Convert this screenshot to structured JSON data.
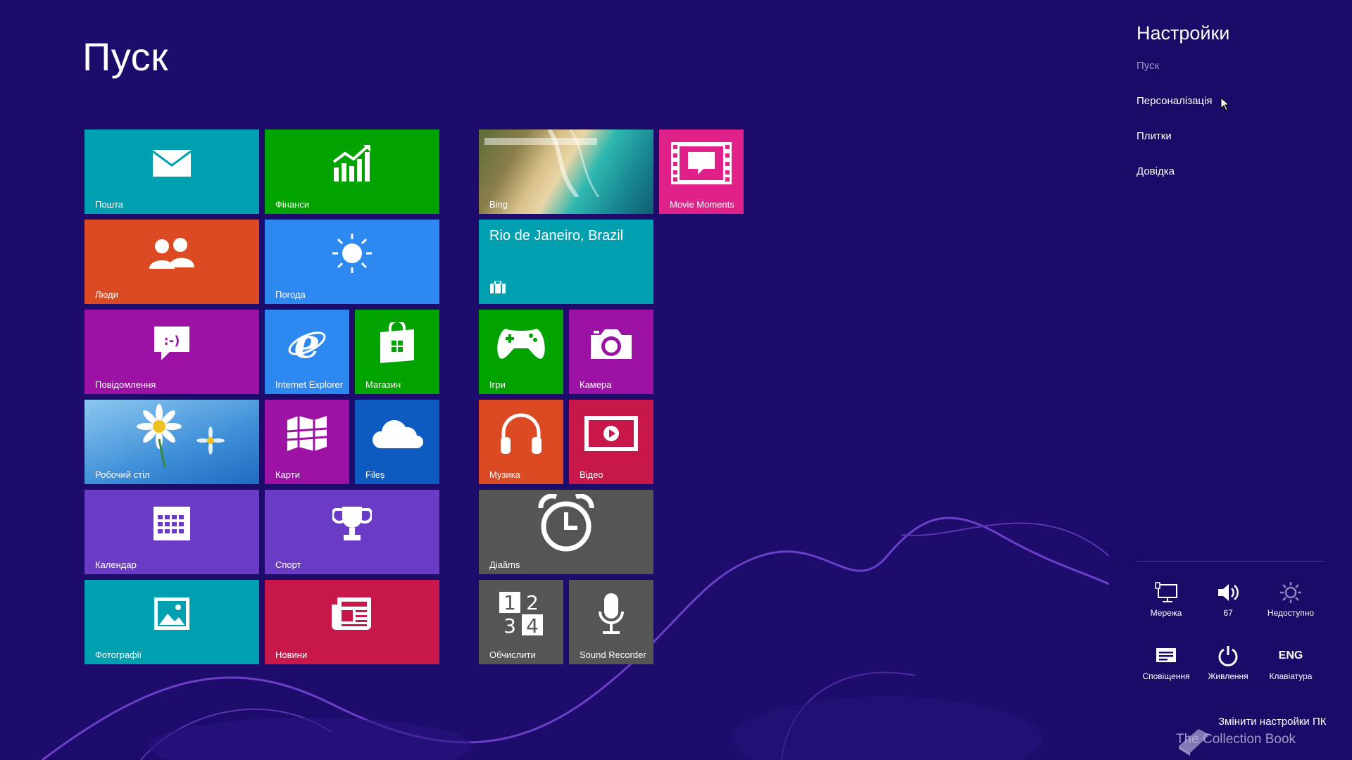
{
  "start": {
    "title": "Пуск"
  },
  "tiles": {
    "mail": "Пошта",
    "finance": "Фінанси",
    "bing": "Bing",
    "movie_moments": "Movie Moments",
    "people": "Люди",
    "weather": "Погода",
    "travel": "Rio de Janeiro, Brazil",
    "messaging": "Повідомлення",
    "ie": "Internet Explorer",
    "store": "Магазин",
    "games": "Ігри",
    "camera": "Камера",
    "desktop": "Робочий стіл",
    "maps": "Карти",
    "files": "Fileș",
    "music": "Музика",
    "video": "Відео",
    "calendar": "Календар",
    "sports": "Спорт",
    "alarms": "Дiaãms",
    "photos": "Фотографії",
    "news": "Новини",
    "calculator": "Обчислити",
    "sound_recorder": "Sound Recorder"
  },
  "charms": {
    "title": "Настройки",
    "subtitle": "Пуск",
    "links": [
      "Персоналізація",
      "Плитки",
      "Довідка"
    ],
    "quick": {
      "network": "Мережа",
      "volume": "67",
      "brightness": "Недоступно",
      "notifications": "Сповіщення",
      "power": "Живлення",
      "keyboard_code": "ENG",
      "keyboard": "Клавіатура"
    },
    "change_pc_settings": "Змінити настройки ПК"
  },
  "watermark": "The Collection Book",
  "colors": {
    "background": "#1d0c6b",
    "teal": "#00a0b1",
    "green": "#00a300",
    "orange": "#dc4a23",
    "blue": "#2d89ef",
    "purple": "#9b12a5",
    "violet": "#6a3bc4",
    "red": "#c8184a",
    "magenta": "#e0218a",
    "gray": "#555555",
    "dark_blue": "#0d5ac1"
  }
}
